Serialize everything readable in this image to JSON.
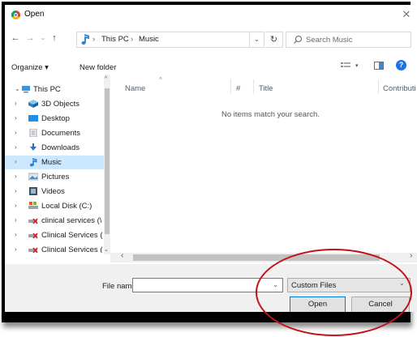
{
  "window": {
    "title": "Open"
  },
  "nav": {
    "path": [
      "This PC",
      "Music"
    ],
    "search_placeholder": "Search Music"
  },
  "toolbar": {
    "organize": "Organize ▾",
    "new_folder": "New folder"
  },
  "tree": [
    {
      "label": "This PC",
      "chev": "⌄"
    },
    {
      "label": "3D Objects",
      "chev": "›"
    },
    {
      "label": "Desktop",
      "chev": "›"
    },
    {
      "label": "Documents",
      "chev": "›"
    },
    {
      "label": "Downloads",
      "chev": "›"
    },
    {
      "label": "Music",
      "chev": "›"
    },
    {
      "label": "Pictures",
      "chev": "›"
    },
    {
      "label": "Videos",
      "chev": "›"
    },
    {
      "label": "Local Disk (C:)",
      "chev": "›"
    },
    {
      "label": "clinical services (\\",
      "chev": "›"
    },
    {
      "label": "Clinical Services (",
      "chev": "›"
    },
    {
      "label": "Clinical Services (",
      "chev": "›"
    }
  ],
  "columns": [
    "Name",
    "#",
    "Title",
    "Contributi"
  ],
  "empty_message": "No items match your search.",
  "footer": {
    "filename_label": "File name:",
    "filename_value": "",
    "filter": "Custom Files",
    "open": "Open",
    "cancel": "Cancel"
  },
  "colors": {
    "selection": "#cce8ff",
    "annotation": "#c0131c",
    "accent": "#0078d7"
  }
}
